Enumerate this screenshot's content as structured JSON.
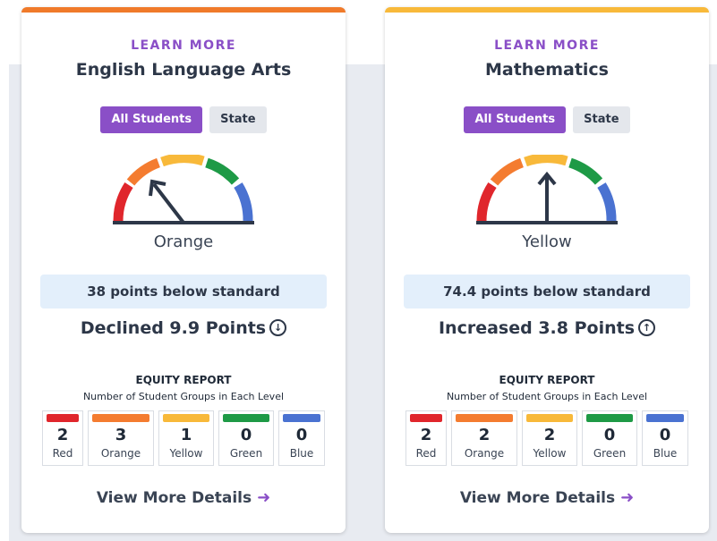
{
  "cards": [
    {
      "learn_more": "LEARN MORE",
      "title": "English Language Arts",
      "accent_color": "#f07a2a",
      "toggle_all": "All Students",
      "toggle_state": "State",
      "gauge_level": "Orange",
      "gauge_icon": "gauge-needle-orange",
      "points": "38 points below standard",
      "change": "Declined 9.9 Points",
      "change_icon": "arrow-down-circle-icon",
      "equity_title": "EQUITY REPORT",
      "equity_subtitle": "Number of Student Groups in Each Level",
      "levels": [
        {
          "name": "Red",
          "count": "2",
          "color": "#e0262c"
        },
        {
          "name": "Orange",
          "count": "3",
          "color": "#f47c30"
        },
        {
          "name": "Yellow",
          "count": "1",
          "color": "#f8b93a"
        },
        {
          "name": "Green",
          "count": "0",
          "color": "#1e9a46"
        },
        {
          "name": "Blue",
          "count": "0",
          "color": "#4a72d1"
        }
      ],
      "view_more": "View More Details"
    },
    {
      "learn_more": "LEARN MORE",
      "title": "Mathematics",
      "accent_color": "#f8b93a",
      "toggle_all": "All Students",
      "toggle_state": "State",
      "gauge_level": "Yellow",
      "gauge_icon": "gauge-needle-yellow",
      "points": "74.4 points below standard",
      "change": "Increased 3.8 Points",
      "change_icon": "arrow-up-circle-icon",
      "equity_title": "EQUITY REPORT",
      "equity_subtitle": "Number of Student Groups in Each Level",
      "levels": [
        {
          "name": "Red",
          "count": "2",
          "color": "#e0262c"
        },
        {
          "name": "Orange",
          "count": "2",
          "color": "#f47c30"
        },
        {
          "name": "Yellow",
          "count": "2",
          "color": "#f8b93a"
        },
        {
          "name": "Green",
          "count": "0",
          "color": "#1e9a46"
        },
        {
          "name": "Blue",
          "count": "0",
          "color": "#4a72d1"
        }
      ],
      "view_more": "View More Details"
    }
  ]
}
